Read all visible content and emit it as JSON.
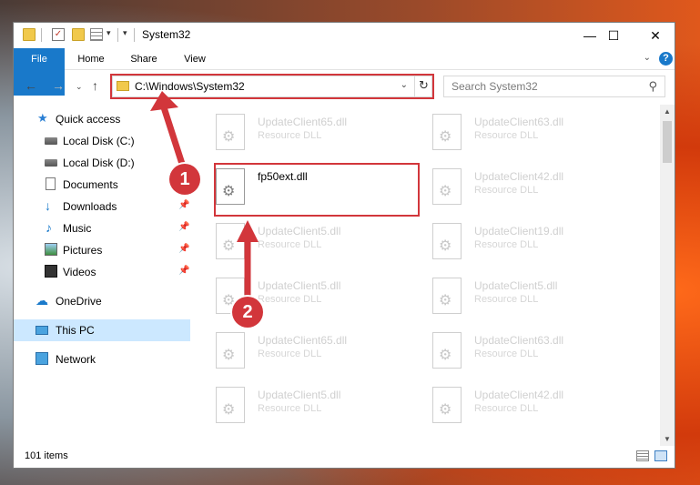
{
  "window": {
    "title": "System32",
    "buttons": {
      "minimize": "—",
      "maximize": "☐",
      "close": "✕"
    }
  },
  "ribbon": {
    "tabs": [
      "File",
      "Home",
      "Share",
      "View"
    ],
    "help": "?"
  },
  "address": {
    "path": "C:\\Windows\\System32",
    "search_placeholder": "Search System32"
  },
  "sidebar": {
    "items": [
      {
        "label": "Quick access",
        "icon": "star-icon"
      },
      {
        "label": "Local Disk (C:)",
        "icon": "drive-icon"
      },
      {
        "label": "Local Disk (D:)",
        "icon": "drive-icon"
      },
      {
        "label": "Documents",
        "icon": "documents-icon"
      },
      {
        "label": "Downloads",
        "icon": "downloads-icon"
      },
      {
        "label": "Music",
        "icon": "music-icon"
      },
      {
        "label": "Pictures",
        "icon": "pictures-icon"
      },
      {
        "label": "Videos",
        "icon": "videos-icon"
      },
      {
        "label": "OneDrive",
        "icon": "onedrive-icon"
      },
      {
        "label": "This PC",
        "icon": "this-pc-icon"
      },
      {
        "label": "Network",
        "icon": "network-icon"
      }
    ]
  },
  "files": [
    {
      "name": "UpdateClient65.dll",
      "type": "Resource DLL"
    },
    {
      "name": "UpdateClient63.dll",
      "type": "Resource DLL"
    },
    {
      "name": "fp50ext.dll",
      "type": ""
    },
    {
      "name": "UpdateClient42.dll",
      "type": "Resource DLL"
    },
    {
      "name": "UpdateClient5.dll",
      "type": "Resource DLL"
    },
    {
      "name": "UpdateClient19.dll",
      "type": "Resource DLL"
    },
    {
      "name": "UpdateClient5.dll",
      "type": "Resource DLL"
    },
    {
      "name": "UpdateClient5.dll",
      "type": "Resource DLL"
    },
    {
      "name": "UpdateClient65.dll",
      "type": "Resource DLL"
    },
    {
      "name": "UpdateClient63.dll",
      "type": "Resource DLL"
    },
    {
      "name": "UpdateClient5.dll",
      "type": "Resource DLL"
    },
    {
      "name": "UpdateClient42.dll",
      "type": "Resource DLL"
    }
  ],
  "status": {
    "item_count": "101 items"
  },
  "annotations": {
    "step1": "1",
    "step2": "2",
    "color": "#d2363b"
  }
}
